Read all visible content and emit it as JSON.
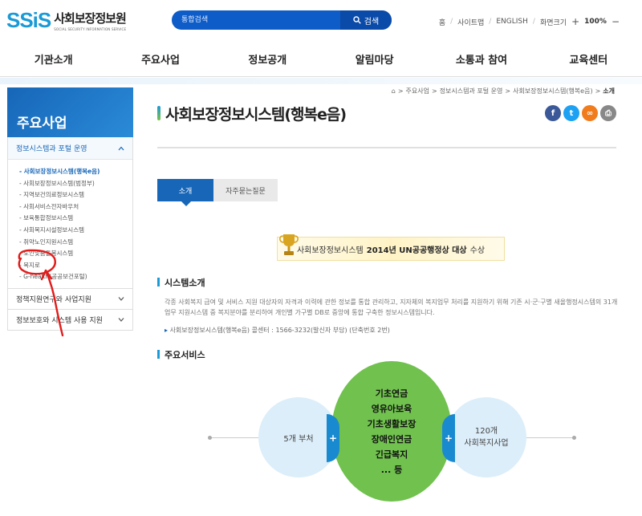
{
  "header": {
    "logo_mark": "SSiS",
    "logo_title": "사회보장정보원",
    "logo_sub": "SOCIAL SECURITY INFORMATION SERVICE",
    "search_placeholder": "통합검색",
    "search_button": "검색",
    "util": {
      "home": "홈",
      "sitemap": "사이트맵",
      "english": "ENGLISH",
      "font_size": "화면크기",
      "zoom": "100%"
    }
  },
  "gnb": [
    "기관소개",
    "주요사업",
    "정보공개",
    "알림마당",
    "소통과 참여",
    "교육센터"
  ],
  "sidebar": {
    "title": "주요사업",
    "section_title": "정보시스템과 포털 운영",
    "items": [
      "사회보장정보시스템(행복e음)",
      "사회보장정보시스템(범정부)",
      "지역보건의료정보시스템",
      "사회서비스전자바우처",
      "보육통합정보시스템",
      "사회복지시설정보시스템",
      "취약노인지원시스템",
      "노인맞춤돌봄시스템",
      "복지로",
      "G-health(공공보건포털)"
    ],
    "collapsed": [
      "정책지원연구와 사업지원",
      "정보보호와 시스템 사용 지원"
    ]
  },
  "breadcrumb": [
    "주요사업",
    "정보시스템과 포털 운영",
    "사회보장정보시스템(행복e음)",
    "소개"
  ],
  "page_title": "사회보장정보시스템(행복e음)",
  "share": {
    "facebook": "f",
    "twitter": "t",
    "link": "∞",
    "print": "⎙"
  },
  "tabs": [
    "소개",
    "자주묻는질문"
  ],
  "award": {
    "pre": "사회보장정보시스템",
    "bold": "2014년 UN공공행정상 대상",
    "post": "수상"
  },
  "intro": {
    "heading": "시스템소개",
    "text": "각종 사회복지 급여 및 서비스 지원 대상자의 자격과 이력에 관한 정보를 통합 관리하고, 지자체의 복지업무 처리를 지원하기 위해 기존 시·군·구별 새올행정시스템의 31개 업무 지원시스템 중 복지분야를 분리하여 개인별 가구별 DB로 중앙에 통합 구축한 정보시스템입니다.",
    "contact": "사회보장정보시스템(행복e음) 콜센터 : 1566-3232(발신자 부담) (단축번호 2번)"
  },
  "services": {
    "heading": "주요서비스",
    "left": "5개 부처",
    "center": [
      "기초연금",
      "영유아보육",
      "기초생활보장",
      "장애인연금",
      "긴급복지",
      "... 등"
    ],
    "right": [
      "120개",
      "사회복지사업"
    ],
    "plus": "+"
  },
  "colors": {
    "primary": "#1766b8",
    "accent": "#1a9ad6",
    "green": "#70c14e",
    "annotation": "#e21b1b"
  }
}
